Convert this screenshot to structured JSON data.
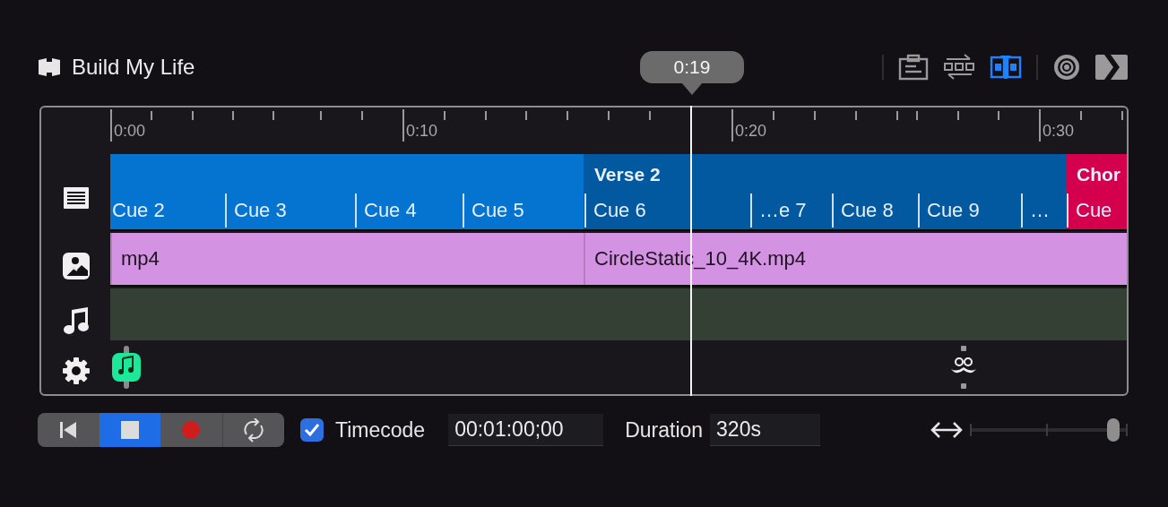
{
  "title": "Build My Life",
  "toolbar": [
    {
      "selected": false
    },
    {
      "selected": false
    },
    {
      "selected": true
    },
    {
      "selected": false
    },
    {
      "selected": false
    }
  ],
  "playhead": {
    "time": "0:19"
  },
  "ruler": [
    "0:00",
    "0:10",
    "0:20",
    "0:30"
  ],
  "cue_groups": [
    {
      "color": "#0474d0",
      "cues": [
        "Cue 2",
        "Cue 3",
        "Cue 4",
        "Cue 5"
      ]
    },
    {
      "label": "Verse 2",
      "color": "#02599f",
      "cues": [
        "Cue 6",
        "…e 7",
        "Cue 8",
        "Cue 9",
        "…"
      ]
    },
    {
      "label": "Chor",
      "color": "#d4004e",
      "cues": [
        "Cue"
      ]
    }
  ],
  "media_clips": [
    "mp4",
    "CircleStatic_10_4K.mp4"
  ],
  "transport": [
    {
      "selected": false
    },
    {
      "selected": true
    },
    {
      "selected": false
    },
    {
      "selected": false
    }
  ],
  "timecode": {
    "label": "Timecode",
    "checked": true,
    "value": "00:01:00;00"
  },
  "duration": {
    "label": "Duration",
    "value": "320s"
  },
  "zoom": {
    "level": 0.92
  }
}
